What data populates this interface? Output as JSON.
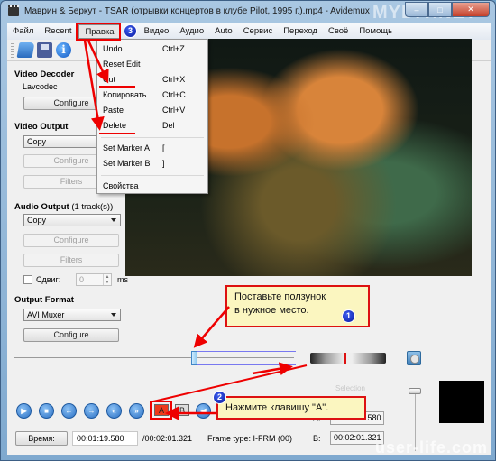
{
  "window": {
    "title": "Маврин & Беркут - TSAR (отрывки концертов в клубе Pilot, 1995 г.).mp4 - Avidemux",
    "minimize": "–",
    "maximize": "□",
    "close": "✕"
  },
  "menubar": {
    "items": [
      "Файл",
      "Recent",
      "Правка",
      "Видео",
      "Аудио",
      "Auto",
      "Сервис",
      "Переход",
      "Своё",
      "Помощь"
    ],
    "active": "Правка"
  },
  "toolbar": {
    "icons": [
      "open-folder-icon",
      "save-icon",
      "info-icon"
    ],
    "info_glyph": "i"
  },
  "edit_menu": {
    "items": [
      {
        "label": "Undo",
        "shortcut": "Ctrl+Z"
      },
      {
        "label": "Reset Edit",
        "shortcut": ""
      },
      {
        "label": "Cut",
        "shortcut": "Ctrl+X"
      },
      {
        "label": "Копировать",
        "shortcut": "Ctrl+C"
      },
      {
        "label": "Paste",
        "shortcut": "Ctrl+V"
      },
      {
        "label": "Delete",
        "shortcut": "Del"
      },
      {
        "label": "Set Marker A",
        "shortcut": "["
      },
      {
        "label": "Set Marker B",
        "shortcut": "]"
      },
      {
        "label": "Свойства",
        "shortcut": ""
      }
    ]
  },
  "left_panel": {
    "video_decoder": {
      "title": "Video Decoder",
      "codec": "Lavcodec",
      "configure": "Configure"
    },
    "video_output": {
      "title": "Video Output",
      "selected": "Copy",
      "configure": "Configure",
      "filters": "Filters"
    },
    "audio_output": {
      "title": "Audio Output",
      "tracks": "(1 track(s))",
      "selected": "Copy",
      "configure": "Configure",
      "filters": "Filters",
      "shift_label": "Сдвиг:",
      "shift_value": "0",
      "shift_unit": "ms",
      "shift_checked": false
    },
    "output_format": {
      "title": "Output Format",
      "selected": "AVI Muxer",
      "configure": "Configure"
    }
  },
  "playback": {
    "position_fraction": 0.65,
    "controls": [
      "play",
      "stop",
      "prev-frame",
      "next-frame",
      "prev-keyframe",
      "next-keyframe"
    ],
    "marker_a": "A",
    "marker_b": "B",
    "time_button": "Время:",
    "current_time": "00:01:19.580",
    "total_time": "/00:02:01.321",
    "frame_type": "Frame type:  I-FRM (00)",
    "selection_title": "Selection",
    "a_label": "A:",
    "a_value": "00:01:19.580",
    "b_label": "B:",
    "b_value": "00:02:01.321"
  },
  "annotations": {
    "callout1": {
      "line1": "Поставьте ползунок",
      "line2": "в нужное место.",
      "badge": "1"
    },
    "callout2": {
      "text": "Нажмите клавишу \"A\".",
      "badge": "2"
    },
    "badge3": "3",
    "accent_color": "#e00000"
  },
  "watermarks": {
    "top": "MYDIV.NET",
    "bottom": "user-life.com"
  }
}
